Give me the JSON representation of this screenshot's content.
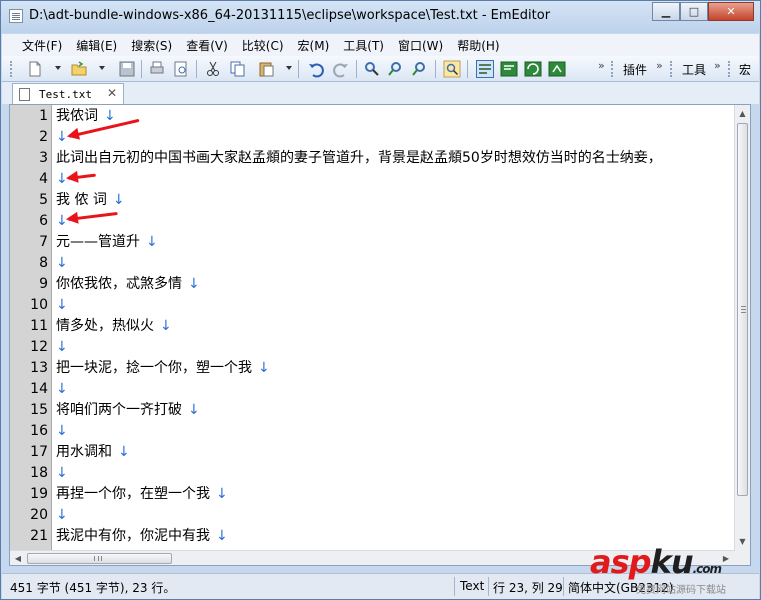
{
  "window": {
    "title": "D:\\adt-bundle-windows-x86_64-20131115\\eclipse\\workspace\\Test.txt - EmEditor",
    "minimize": "▁",
    "maximize": "□",
    "close": "✕"
  },
  "menu": [
    "文件(F)",
    "编辑(E)",
    "搜索(S)",
    "查看(V)",
    "比较(C)",
    "宏(M)",
    "工具(T)",
    "窗口(W)",
    "帮助(H)"
  ],
  "toolbar": {
    "plugins_label": "插件",
    "tools_label": "工具",
    "macro_label": "宏",
    "more": "»"
  },
  "tab": {
    "label": "Test.txt",
    "close": "✕"
  },
  "editor": {
    "eol_mark": "↓",
    "lines": [
      {
        "no": "1",
        "text": "我侬词"
      },
      {
        "no": "2",
        "text": ""
      },
      {
        "no": "3",
        "text": "此词出自元初的中国书画大家赵孟頫的妻子管道升，背景是赵孟頫50岁时想效仿当时的名士纳妾，"
      },
      {
        "no": "4",
        "text": ""
      },
      {
        "no": "5",
        "text": "我 侬 词"
      },
      {
        "no": "6",
        "text": ""
      },
      {
        "no": "7",
        "text": "元——管道升"
      },
      {
        "no": "8",
        "text": ""
      },
      {
        "no": "9",
        "text": "你侬我侬，忒煞多情"
      },
      {
        "no": "10",
        "text": ""
      },
      {
        "no": "11",
        "text": "情多处，热似火"
      },
      {
        "no": "12",
        "text": ""
      },
      {
        "no": "13",
        "text": "把一块泥，捻一个你，塑一个我"
      },
      {
        "no": "14",
        "text": ""
      },
      {
        "no": "15",
        "text": "将咱们两个一齐打破"
      },
      {
        "no": "16",
        "text": ""
      },
      {
        "no": "17",
        "text": "用水调和"
      },
      {
        "no": "18",
        "text": ""
      },
      {
        "no": "19",
        "text": "再捏一个你，在塑一个我"
      },
      {
        "no": "20",
        "text": ""
      },
      {
        "no": "21",
        "text": "我泥中有你，你泥中有我"
      }
    ]
  },
  "status": {
    "summary": "451 字节 (451 字节), 23 行。",
    "mode": "Text",
    "position": "行 23, 列 29",
    "encoding": "简体中文(GB2312)"
  },
  "watermark": {
    "brand_left": "asp",
    "brand_right": "ku",
    "brand_tld": ".com",
    "tagline": "免费网站源码下载站"
  },
  "colors": {
    "annotation_arrow": "#e8141a",
    "eol_mark": "#2b6fd6",
    "gutter": "#d4d4d4"
  }
}
